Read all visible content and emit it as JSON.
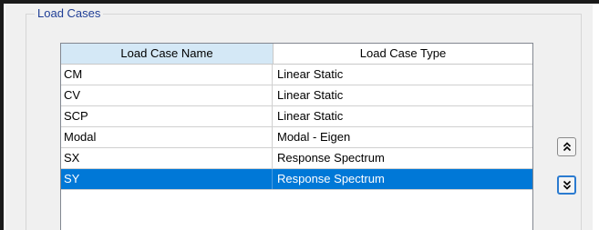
{
  "group": {
    "title": "Load Cases"
  },
  "table": {
    "columns": [
      "Load Case Name",
      "Load Case Type"
    ],
    "rows": [
      {
        "name": "CM",
        "type": "Linear Static"
      },
      {
        "name": "CV",
        "type": "Linear Static"
      },
      {
        "name": "SCP",
        "type": "Linear Static"
      },
      {
        "name": "Modal",
        "type": "Modal - Eigen"
      },
      {
        "name": "SX",
        "type": "Response Spectrum"
      },
      {
        "name": "SY",
        "type": "Response Spectrum"
      }
    ],
    "selected_row": 5,
    "selection_color": "#0078d7",
    "header_highlight_color": "#d4e8f6"
  },
  "buttons": {
    "move_up_icon": "double-chevron-up-icon",
    "move_down_icon": "double-chevron-down-icon"
  }
}
